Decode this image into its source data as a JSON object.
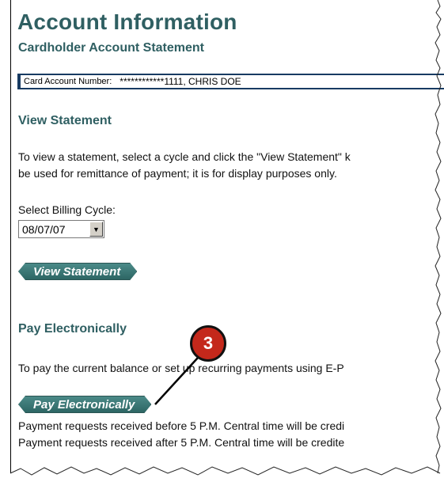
{
  "header": {
    "title": "Account Information",
    "subtitle": "Cardholder Account Statement"
  },
  "account": {
    "label": "Card Account Number:",
    "value": "************1111, CHRIS DOE"
  },
  "view_statement": {
    "heading": "View Statement",
    "text_line1": "To view a statement, select a cycle and click the \"View Statement\" k",
    "text_line2": "be used for remittance of payment; it is for display purposes only.",
    "select_label": "Select Billing Cycle:",
    "selected_cycle": "08/07/07",
    "button_label": "View Statement"
  },
  "pay": {
    "heading": "Pay Electronically",
    "text_line1": "To pay the current balance or set up recurring payments using E-P",
    "button_label": "Pay Electronically",
    "note_line1": "Payment requests received before 5 P.M. Central time will be credi",
    "note_line2": "Payment requests received after 5 P.M. Central time will be credite"
  },
  "callout": {
    "number": "3",
    "color": "#c4281b"
  },
  "theme": {
    "heading_color": "#2f5f62",
    "bar_color": "#183b62",
    "button_color": "#3a7675"
  }
}
